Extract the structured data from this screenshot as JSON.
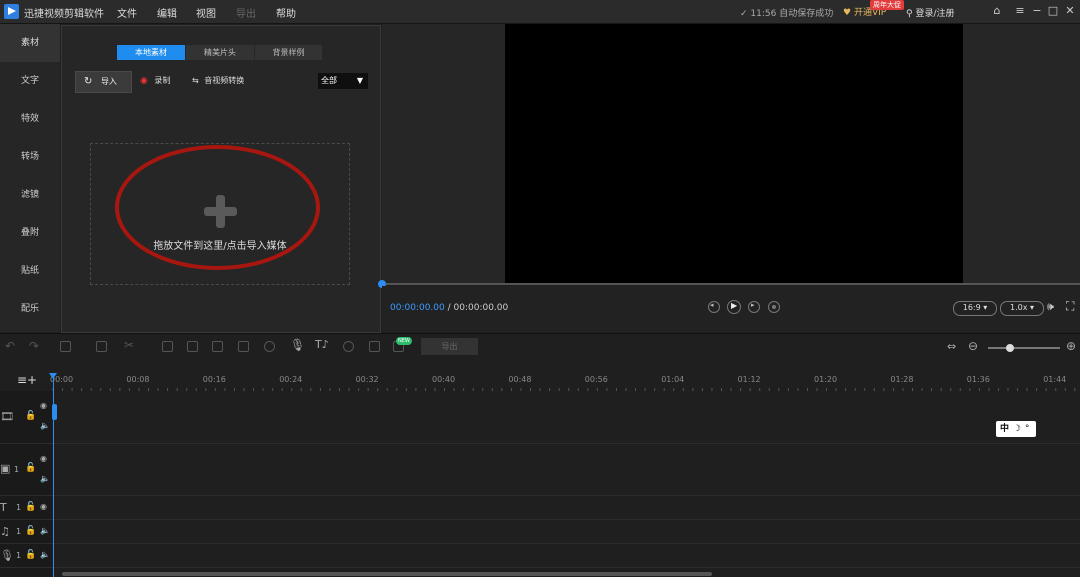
{
  "titlebar": {
    "app_name": "迅捷视频剪辑软件",
    "menus": [
      "文件",
      "编辑",
      "视图",
      "导出",
      "帮助"
    ],
    "save_status": "11:56 自动保存成功",
    "vip_label": "开通VIP",
    "vip_badge": "周年大促",
    "login_label": "登录/注册"
  },
  "sidebar": {
    "items": [
      {
        "label": "素材"
      },
      {
        "label": "文字"
      },
      {
        "label": "特效"
      },
      {
        "label": "转场"
      },
      {
        "label": "滤镜"
      },
      {
        "label": "叠附"
      },
      {
        "label": "贴纸"
      },
      {
        "label": "配乐"
      }
    ]
  },
  "media": {
    "tabs": [
      "本地素材",
      "精美片头",
      "背景样例"
    ],
    "import_label": "导入",
    "record_label": "录制",
    "convert_label": "音视频转换",
    "filter_value": "全部",
    "drop_text": "拖放文件到这里/点击导入媒体"
  },
  "player": {
    "current_time": "00:00:00.00",
    "total_time": "/ 00:00:00.00",
    "aspect": "16:9",
    "speed": "1.0x"
  },
  "toolbar": {
    "export_label": "导出",
    "new_badge": "NEW"
  },
  "timeline": {
    "ticks": [
      "00:00",
      "00:08",
      "00:16",
      "00:24",
      "00:32",
      "00:40",
      "00:48",
      "00:56",
      "01:04",
      "01:12",
      "01:20",
      "01:28",
      "01:36",
      "01:44"
    ],
    "track_numbers": [
      "1",
      "1",
      "1",
      "1"
    ]
  },
  "ime": {
    "label": "中"
  },
  "colors": {
    "accent": "#1f8cf0",
    "annotation_ring": "#a8170f"
  }
}
